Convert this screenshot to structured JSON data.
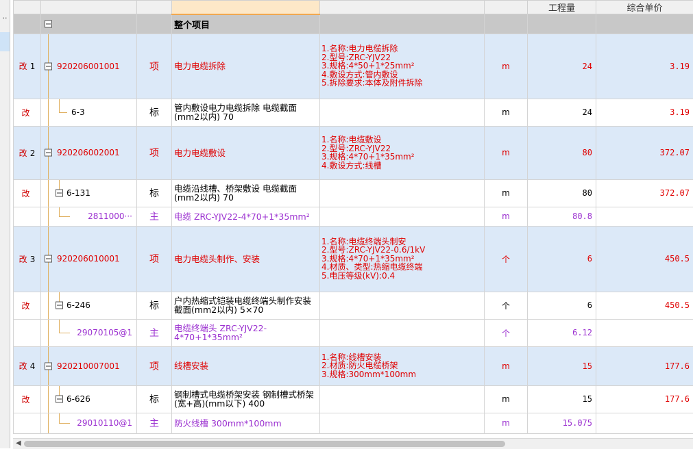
{
  "header": {
    "col0": "",
    "col1": "",
    "col2": "",
    "col3": "",
    "col4": "",
    "col5": "",
    "col6": "工程量",
    "col7": "综合单价"
  },
  "group": {
    "title": "整个项目"
  },
  "rows": [
    {
      "mark": "改",
      "num": "1",
      "code": "920206001001",
      "type": "项",
      "name": "电力电缆拆除",
      "feature": "1.名称:电力电缆拆除\n2.型号:ZRC-YJV22\n3.规格:4*50+1*25mm²\n4.敷设方式:管内敷设\n5.拆除要求:本体及附件拆除",
      "unit": "m",
      "qty": "24",
      "price": "3.19"
    },
    {
      "mark": "改",
      "num": "",
      "code": "6-3",
      "type": "标",
      "name": "管内敷设电力电缆拆除 电缆截面(mm2以内) 70",
      "feature": "",
      "unit": "m",
      "qty": "24",
      "price": "3.19"
    },
    {
      "mark": "改",
      "num": "2",
      "code": "920206002001",
      "type": "项",
      "name": "电力电缆敷设",
      "feature": "1.名称:电缆敷设\n2.型号:ZRC-YJV22\n3.规格:4*70+1*35mm²\n4.敷设方式:线槽",
      "unit": "m",
      "qty": "80",
      "price": "372.07"
    },
    {
      "mark": "改",
      "num": "",
      "code": "6-131",
      "type": "标",
      "name": "电缆沿线槽、桥架敷设 电缆截面(mm2以内) 70",
      "feature": "",
      "unit": "m",
      "qty": "80",
      "price": "372.07"
    },
    {
      "mark": "",
      "num": "",
      "code": "2811000···",
      "type": "主",
      "name": "电缆 ZRC-YJV22-4*70+1*35mm²",
      "feature": "",
      "unit": "m",
      "qty": "80.8",
      "price": ""
    },
    {
      "mark": "改",
      "num": "3",
      "code": "920206010001",
      "type": "项",
      "name": "电力电缆头制作、安装",
      "feature": "1.名称:电缆终端头制安\n2.型号:ZRC-YJV22-0.6/1kV\n3.规格:4*70+1*35mm²\n4.材质、类型:热缩电缆终端\n5.电压等级(kV):0.4",
      "unit": "个",
      "qty": "6",
      "price": "450.5"
    },
    {
      "mark": "改",
      "num": "",
      "code": "6-246",
      "type": "标",
      "name": "户内热缩式铠装电缆终端头制作安装 截面(mm2以内) 5×70",
      "feature": "",
      "unit": "个",
      "qty": "6",
      "price": "450.5"
    },
    {
      "mark": "",
      "num": "",
      "code": "29070105@1",
      "type": "主",
      "name": "电缆终端头 ZRC-YJV22-4*70+1*35mm²",
      "feature": "",
      "unit": "个",
      "qty": "6.12",
      "price": ""
    },
    {
      "mark": "改",
      "num": "4",
      "code": "920210007001",
      "type": "项",
      "name": "线槽安装",
      "feature": "1.名称:线槽安装\n2.材质:防火电缆桥架\n3.规格:300mm*100mm",
      "unit": "m",
      "qty": "15",
      "price": "177.6"
    },
    {
      "mark": "改",
      "num": "",
      "code": "6-626",
      "type": "标",
      "name": "钢制槽式电缆桥架安装 钢制槽式桥架(宽+高)(mm以下) 400",
      "feature": "",
      "unit": "m",
      "qty": "15",
      "price": "177.6"
    },
    {
      "mark": "",
      "num": "",
      "code": "29010110@1",
      "type": "主",
      "name": "防火线槽 300mm*100mm",
      "feature": "",
      "unit": "m",
      "qty": "15.075",
      "price": ""
    }
  ],
  "colors": {
    "item_row_bg": "#dce9f8",
    "group_row_bg": "#c8c8c8",
    "accent_red": "#e00000",
    "material_purple": "#9b30d0",
    "tree_line": "#e0b060"
  },
  "icons": {
    "expand": "minus-box-icon",
    "scroll_left": "arrow-left-icon"
  }
}
